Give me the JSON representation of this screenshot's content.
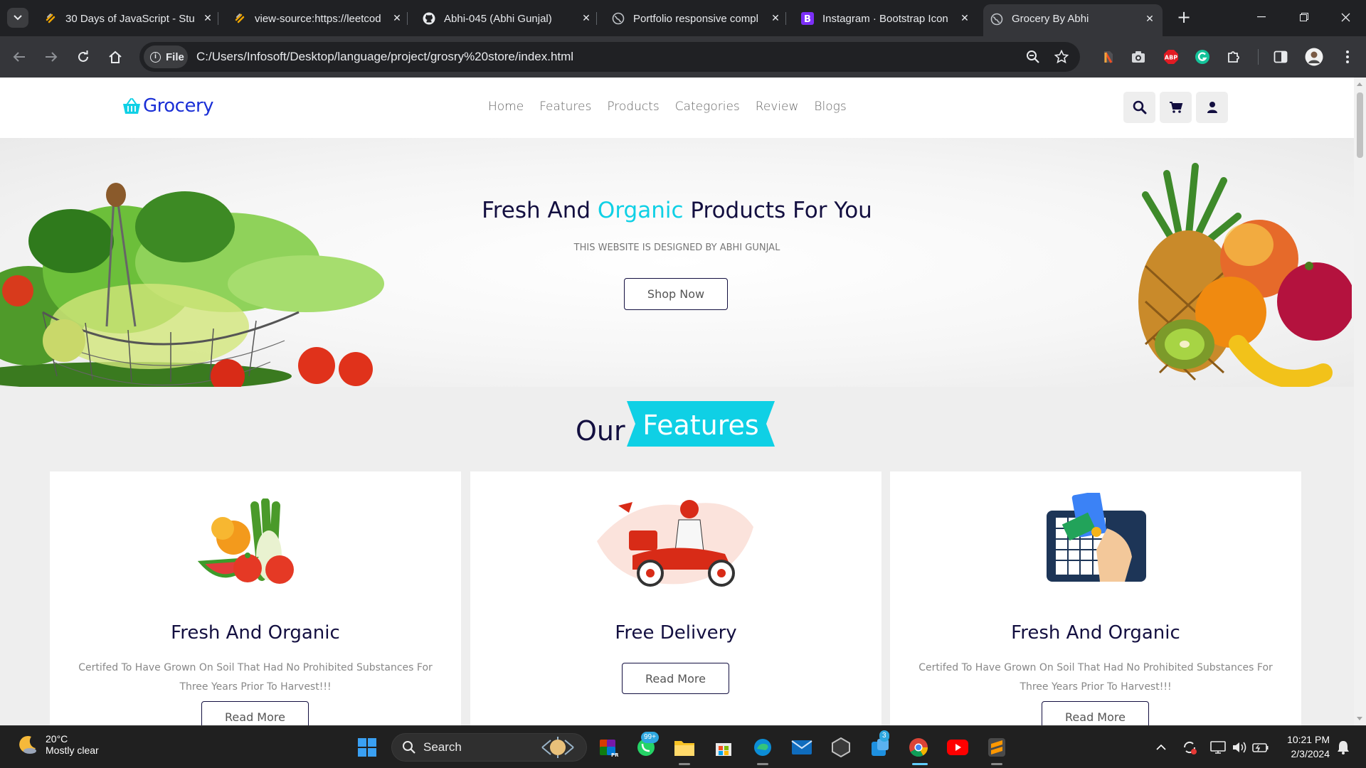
{
  "browser": {
    "tabs": [
      {
        "title": "30 Days of JavaScript - Stu",
        "icon": "codefire-icon"
      },
      {
        "title": "view-source:https://leetcod",
        "icon": "codefire-icon"
      },
      {
        "title": "Abhi-045 (Abhi Gunjal)",
        "icon": "github-icon"
      },
      {
        "title": "Portfolio responsive compl",
        "icon": "globe-icon"
      },
      {
        "title": "Instagram · Bootstrap Icon",
        "icon": "bootstrap-icon"
      },
      {
        "title": "Grocery By Abhi",
        "icon": "globe-icon",
        "active": true
      }
    ],
    "new_tab_label": "+",
    "address": {
      "scheme_chip": "File",
      "url": "C:/Users/Infosoft/Desktop/language/project/grosry%20store/index.html"
    },
    "extensions": [
      "pdf-icon",
      "camera-icon",
      "adblock-icon",
      "grammarly-icon",
      "puzzle-icon",
      "sidepanel-icon",
      "profile-avatar"
    ],
    "adblock_label": "ABP"
  },
  "site": {
    "logo": "Grocery",
    "nav": [
      "Home",
      "Features",
      "Products",
      "Categories",
      "Review",
      "Blogs"
    ],
    "header_icons": [
      "search-icon",
      "cart-icon",
      "user-icon"
    ],
    "hero": {
      "title_before": "Fresh And ",
      "title_accent": "Organic",
      "title_after": " Products For You",
      "subtitle": "THIS WEBSITE IS DESIGNED BY ABHI GUNJAL",
      "cta": "Shop Now"
    },
    "features_heading": {
      "prefix": "Our",
      "highlight": "Features"
    },
    "features": [
      {
        "title": "Fresh And Organic",
        "desc": "Certifed To Have Grown On Soil That Had No Prohibited Substances For Three Years Prior To Harvest!!!",
        "button": "Read More",
        "image": "vegetables-icon"
      },
      {
        "title": "Free Delivery",
        "desc": "",
        "button": "Read More",
        "image": "delivery-scooter-icon"
      },
      {
        "title": "Fresh And Organic",
        "desc": "Certifed To Have Grown On Soil That Had No Prohibited Substances For Three Years Prior To Harvest!!!",
        "button": "Read More",
        "image": "card-payment-icon"
      }
    ],
    "colors": {
      "brand": "#1a2fd6",
      "accent": "#0fd0e5",
      "dark": "#130f40"
    }
  },
  "taskbar": {
    "weather": {
      "temp": "20°C",
      "desc": "Mostly clear"
    },
    "search_label": "Search",
    "badges": {
      "whatsapp": "99+",
      "store": "3"
    },
    "clock": {
      "time": "10:21 PM",
      "date": "2/3/2024"
    }
  }
}
